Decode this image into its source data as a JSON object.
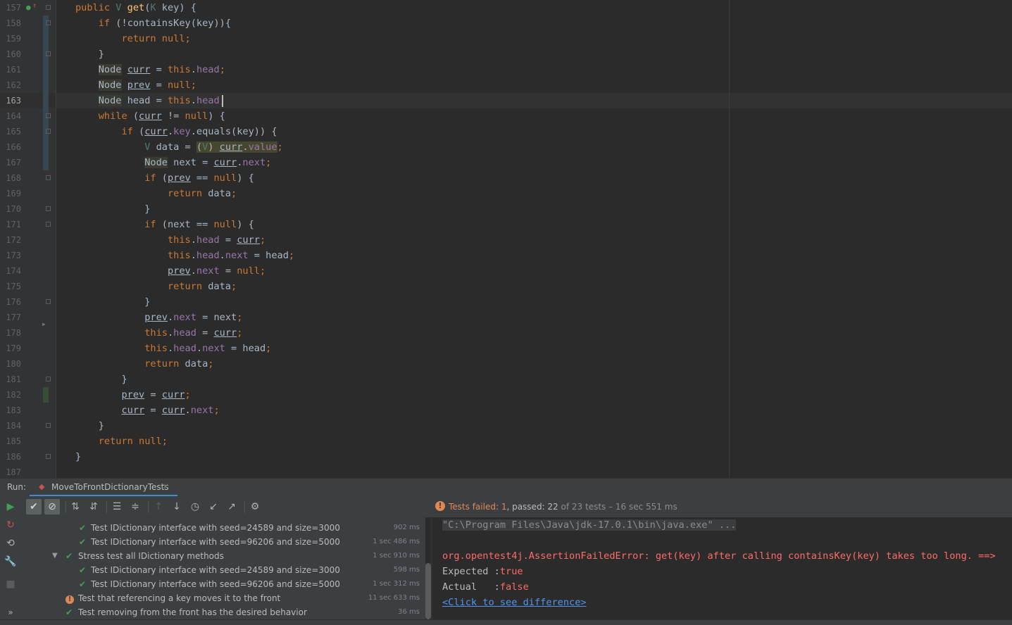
{
  "editor": {
    "current_line": "163",
    "lines": [
      {
        "n": "157"
      },
      {
        "n": "158"
      },
      {
        "n": "159"
      },
      {
        "n": "160"
      },
      {
        "n": "161"
      },
      {
        "n": "162"
      },
      {
        "n": "163"
      },
      {
        "n": "164"
      },
      {
        "n": "165"
      },
      {
        "n": "166"
      },
      {
        "n": "167"
      },
      {
        "n": "168"
      },
      {
        "n": "169"
      },
      {
        "n": "170"
      },
      {
        "n": "171"
      },
      {
        "n": "172"
      },
      {
        "n": "173"
      },
      {
        "n": "174"
      },
      {
        "n": "175"
      },
      {
        "n": "176"
      },
      {
        "n": "177"
      },
      {
        "n": "178"
      },
      {
        "n": "179"
      },
      {
        "n": "180"
      },
      {
        "n": "181"
      },
      {
        "n": "182"
      },
      {
        "n": "183"
      },
      {
        "n": "184"
      },
      {
        "n": "185"
      },
      {
        "n": "186"
      },
      {
        "n": "187"
      }
    ],
    "tokens": {
      "public": "public",
      "v_type": "V",
      "get": "get",
      "k_type": "K",
      "key": "key",
      "if": "if",
      "containsKey": "containsKey",
      "return": "return",
      "null": "null",
      "node": "Node",
      "curr": "curr",
      "prev": "prev",
      "head": "head",
      "this": "this",
      "while": "while",
      "equals": "equals",
      "data": "data",
      "value": "value",
      "next": "next"
    }
  },
  "run": {
    "label": "Run:",
    "tab_name": "MoveToFrontDictionaryTests",
    "tab_close": "×",
    "status": {
      "failed_label": "Tests failed: ",
      "failed_count": "1",
      "passed_label": ", passed: ",
      "passed_count": "22",
      "suffix": " of 23 tests – 16 sec 551 ms",
      "icon": "!"
    },
    "tests": [
      {
        "name": "Test IDictionary interface with seed=24589 and size=3000",
        "duration": "902 ms",
        "status": "passed"
      },
      {
        "name": "Test IDictionary interface with seed=96206 and size=5000",
        "duration": "1 sec 486 ms",
        "status": "passed"
      },
      {
        "name": "Stress test all IDictionary methods",
        "duration": "1 sec 910 ms",
        "status": "passed"
      },
      {
        "name": "Test IDictionary interface with seed=24589 and size=3000",
        "duration": "598 ms",
        "status": "passed"
      },
      {
        "name": "Test IDictionary interface with seed=96206 and size=5000",
        "duration": "1 sec 312 ms",
        "status": "passed"
      },
      {
        "name": "Test that referencing a key moves it to the front",
        "duration": "11 sec 633 ms",
        "status": "failed"
      },
      {
        "name": "Test removing from the front has the desired behavior",
        "duration": "36 ms",
        "status": "passed"
      }
    ],
    "console": {
      "command": "\"C:\\Program Files\\Java\\jdk-17.0.1\\bin\\java.exe\" ...",
      "error": "org.opentest4j.AssertionFailedError: get(key) after calling containsKey(key) takes too long. ==>",
      "expected_label": "Expected :",
      "expected_value": "true",
      "actual_label": "Actual   :",
      "actual_value": "false",
      "diff_link": "<Click to see difference>"
    }
  },
  "colors": {
    "keyword": "#cc7832",
    "method": "#ffc66d",
    "field": "#9876aa",
    "error": "#ff6b68",
    "pass": "#499c54",
    "fail": "#e08855",
    "link": "#5394ec"
  }
}
